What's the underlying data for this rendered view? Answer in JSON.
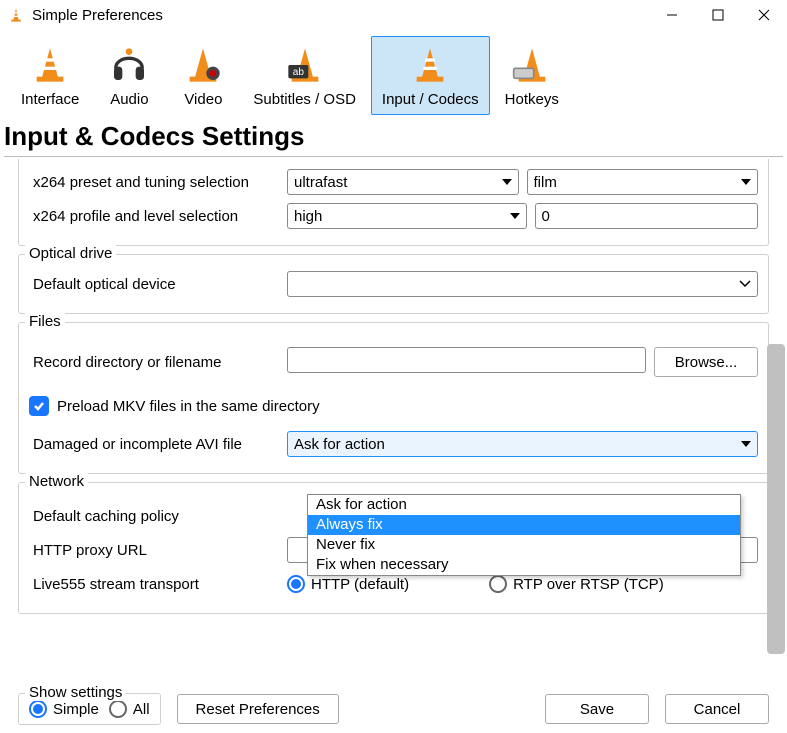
{
  "window": {
    "title": "Simple Preferences"
  },
  "tabs": [
    {
      "id": "interface",
      "label": "Interface"
    },
    {
      "id": "audio",
      "label": "Audio"
    },
    {
      "id": "video",
      "label": "Video"
    },
    {
      "id": "subtitles",
      "label": "Subtitles / OSD"
    },
    {
      "id": "input-codecs",
      "label": "Input / Codecs"
    },
    {
      "id": "hotkeys",
      "label": "Hotkeys"
    }
  ],
  "active_tab": "input-codecs",
  "page_heading": "Input & Codecs Settings",
  "x264": {
    "preset_label": "x264 preset and tuning selection",
    "preset_value": "ultrafast",
    "tuning_value": "film",
    "profile_label": "x264 profile and level selection",
    "profile_value": "high",
    "level_value": "0"
  },
  "optical": {
    "legend": "Optical drive",
    "device_label": "Default optical device",
    "device_value": ""
  },
  "files": {
    "legend": "Files",
    "record_label": "Record directory or filename",
    "record_value": "",
    "browse_label": "Browse...",
    "preload_label": "Preload MKV files in the same directory",
    "preload_checked": true,
    "avi_label": "Damaged or incomplete AVI file",
    "avi_value": "Ask for action",
    "avi_options": [
      "Ask for action",
      "Always fix",
      "Never fix",
      "Fix when necessary"
    ],
    "avi_highlighted_index": 1
  },
  "network": {
    "legend": "Network",
    "caching_label": "Default caching policy",
    "proxy_label": "HTTP proxy URL",
    "proxy_value": "",
    "live555_label": "Live555 stream transport",
    "live555_http": "HTTP (default)",
    "live555_rtp": "RTP over RTSP (TCP)",
    "live555_selected": "http"
  },
  "bottom": {
    "show_settings_legend": "Show settings",
    "simple_label": "Simple",
    "all_label": "All",
    "selected": "simple",
    "reset_label": "Reset Preferences",
    "save_label": "Save",
    "cancel_label": "Cancel"
  }
}
